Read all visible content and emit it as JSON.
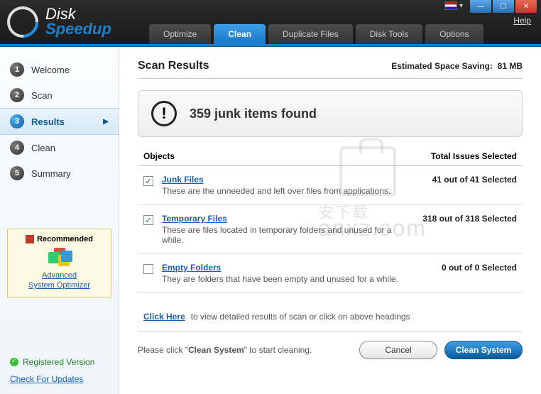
{
  "app": {
    "name_line1": "Disk",
    "name_line2": "Speedup"
  },
  "window": {
    "help": "Help"
  },
  "tabs": [
    {
      "label": "Optimize"
    },
    {
      "label": "Clean"
    },
    {
      "label": "Duplicate Files"
    },
    {
      "label": "Disk Tools"
    },
    {
      "label": "Options"
    }
  ],
  "sidebar": {
    "steps": [
      {
        "num": "1",
        "label": "Welcome"
      },
      {
        "num": "2",
        "label": "Scan"
      },
      {
        "num": "3",
        "label": "Results"
      },
      {
        "num": "4",
        "label": "Clean"
      },
      {
        "num": "5",
        "label": "Summary"
      }
    ],
    "recommend": {
      "header": "Recommended",
      "link1": "Advanced",
      "link2": "System Optimizer"
    },
    "registered": "Registered Version",
    "updates": "Check For Updates"
  },
  "main": {
    "title": "Scan Results",
    "estimated_label": "Estimated Space Saving:",
    "estimated_value": "81 MB",
    "found_text": "359 junk items found",
    "col_objects": "Objects",
    "col_issues": "Total Issues Selected",
    "rows": [
      {
        "title": "Junk Files",
        "desc": "These are the unneeded and left over files from applications.",
        "count": "41 out of 41 Selected",
        "checked": true
      },
      {
        "title": "Temporary Files",
        "desc": "These are files located in temporary folders and unused for a while.",
        "count": "318 out of 318 Selected",
        "checked": true
      },
      {
        "title": "Empty Folders",
        "desc": "They are folders that have been empty and unused for a while.",
        "count": "0 out of 0 Selected",
        "checked": false
      }
    ],
    "clickhere": "Click Here",
    "clickhere_rest": "to view detailed results of scan or click on above headings",
    "footer_text_pre": "Please click \"",
    "footer_text_bold": "Clean System",
    "footer_text_post": "\" to start cleaning.",
    "cancel": "Cancel",
    "clean": "Clean System"
  },
  "watermark": "anxz.com"
}
